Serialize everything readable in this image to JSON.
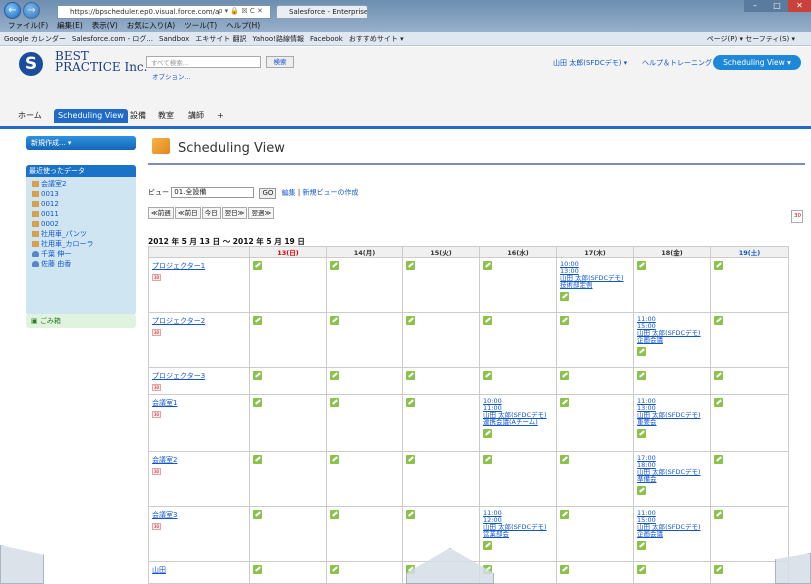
{
  "browser": {
    "address": "https://bpscheduler.ep0.visual.force.com/a",
    "address_controls": "ρ ▾ 🔒 ☒ C ✕",
    "tab_title": "Salesforce - Enterprise E...",
    "menu": [
      "ファイル(F)",
      "編集(E)",
      "表示(V)",
      "お気に入り(A)",
      "ツール(T)",
      "ヘルプ(H)"
    ],
    "favorites": [
      "Google カレンダー",
      "Salesforce.com - ログ...",
      "Sandbox",
      "エキサイト 翻訳",
      "Yahoo!路線情報",
      "Facebook",
      "おすすめサイト ▾"
    ],
    "favorites_right": "ページ(P) ▾  セーフティ(S) ▾"
  },
  "header": {
    "logo_text_1": "BEST",
    "logo_text_2": "PRACTICE Inc.",
    "search_placeholder": "すべて検索...",
    "search_button": "検索",
    "options": "オプション...",
    "user_menu": "山田 太郎(SFDCデモ) ▾",
    "help_menu": "ヘルプ＆トレーニング",
    "app_menu": "Scheduling View ▾"
  },
  "tabs": [
    "ホーム",
    "Scheduling View",
    "設備",
    "教室",
    "講師",
    "+"
  ],
  "sidebar": {
    "new_button": "新規作成...",
    "recent_title": "最近使ったデータ",
    "recent": [
      "会議室2",
      "0013",
      "0012",
      "0011",
      "0002",
      "社用車_パンツ",
      "社用車_カローラ",
      "千葉 伸一",
      "佐藤 由香"
    ],
    "trash": "ごみ箱"
  },
  "main": {
    "title": "Scheduling View",
    "view_label": "ビュー",
    "view_value": "01.全設備",
    "go": "GO",
    "edit_link": "編集",
    "new_view_link": "新規ビューの作成",
    "nav": [
      "≪前週",
      "≪前日",
      "今日",
      "翌日≫",
      "翌週≫"
    ],
    "calendar_icon": "30",
    "range": "2012 年 5 月 13 日 〜 2012 年 5 月 19 日",
    "res_icon": "30",
    "days": [
      {
        "label": "13(日)",
        "kind": "sun"
      },
      {
        "label": "14(月)",
        "kind": ""
      },
      {
        "label": "15(火)",
        "kind": ""
      },
      {
        "label": "16(水)",
        "kind": ""
      },
      {
        "label": "17(木)",
        "kind": ""
      },
      {
        "label": "18(金)",
        "kind": ""
      },
      {
        "label": "19(土)",
        "kind": "sat"
      }
    ],
    "rows": [
      {
        "name": "プロジェクター1",
        "events": {
          "4": [
            "10:00",
            "13:00",
            "山田 太郎(SFDCデモ)",
            "技術部定例"
          ]
        }
      },
      {
        "name": "プロジェクター2",
        "events": {
          "5": [
            "11:00",
            "15:00",
            "山田 太郎(SFDCデモ)",
            "企画会議"
          ]
        }
      },
      {
        "name": "プロジェクター3",
        "events": {}
      },
      {
        "name": "会議室1",
        "events": {
          "3": [
            "10:00",
            "11:00",
            "山田 太郎(SFDCデモ)",
            "連携会議(Aチーム)"
          ],
          "5": [
            "11:00",
            "13:00",
            "山田 太郎(SFDCデモ)",
            "重要会"
          ]
        }
      },
      {
        "name": "会議室2",
        "events": {
          "5": [
            "17:00",
            "18:00",
            "山田 太郎(SFDCデモ)",
            "準備会"
          ]
        }
      },
      {
        "name": "会議室3",
        "events": {
          "3": [
            "11:00",
            "12:00",
            "山田 太郎(SFDCデモ)",
            "営業部会"
          ],
          "5": [
            "11:00",
            "15:00",
            "山田 太郎(SFDCデモ)",
            "企画会議"
          ]
        }
      },
      {
        "name": "山田",
        "events": {}
      }
    ]
  }
}
